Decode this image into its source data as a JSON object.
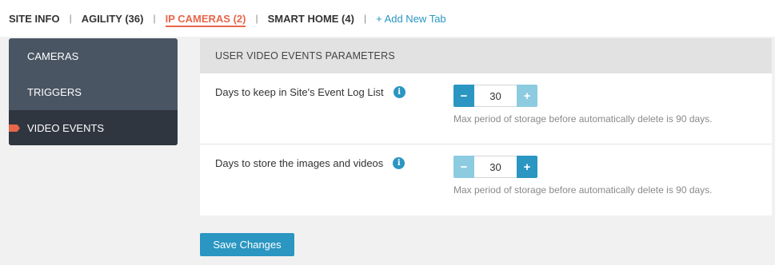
{
  "tabs": {
    "items": [
      {
        "label": "SITE INFO",
        "active": false
      },
      {
        "label": "AGILITY (36)",
        "active": false
      },
      {
        "label": "IP CAMERAS (2)",
        "active": true
      },
      {
        "label": "SMART HOME (4)",
        "active": false
      }
    ],
    "separator": "|",
    "add_label": "+ Add New Tab"
  },
  "sidebar": {
    "items": [
      {
        "label": "CAMERAS",
        "active": false
      },
      {
        "label": "TRIGGERS",
        "active": false
      },
      {
        "label": "VIDEO EVENTS",
        "active": true
      }
    ]
  },
  "panel": {
    "title": "USER VIDEO EVENTS PARAMETERS",
    "rows": [
      {
        "label": "Days to keep in Site's Event Log List",
        "info_icon": "info-icon",
        "value": "30",
        "minus_symbol": "−",
        "plus_symbol": "+",
        "minus_enabled": true,
        "plus_enabled": false,
        "hint": "Max period of storage before automatically delete is 90 days."
      },
      {
        "label": "Days to store the images and videos",
        "info_icon": "info-icon",
        "value": "30",
        "minus_symbol": "−",
        "plus_symbol": "+",
        "minus_enabled": false,
        "plus_enabled": true,
        "hint": "Max period of storage before automatically delete is 90 days."
      }
    ]
  },
  "save_label": "Save Changes",
  "colors": {
    "accent": "#2a96c1",
    "active_tab": "#e8664a",
    "sidebar_bg": "#4a5563",
    "sidebar_active_bg": "#2f3640"
  }
}
